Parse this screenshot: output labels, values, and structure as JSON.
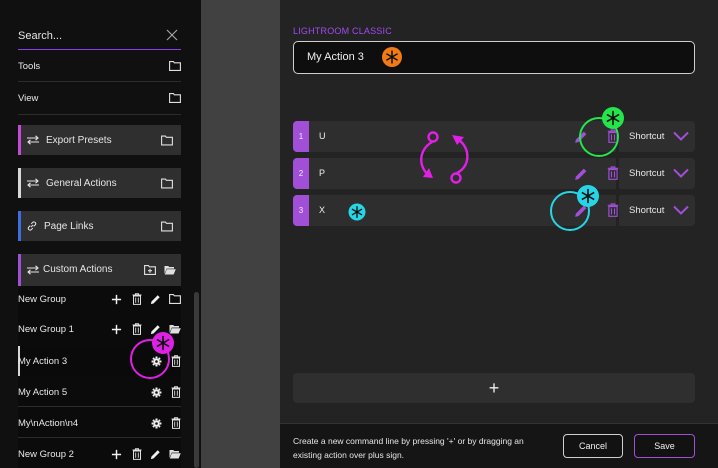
{
  "sidebar": {
    "search_placeholder": "Search...",
    "top_items": [
      {
        "label": "Tools"
      },
      {
        "label": "View"
      }
    ],
    "categories": {
      "export_presets": {
        "label": "Export Presets",
        "color": "#c34bd8"
      },
      "general_actions": {
        "label": "General Actions",
        "color": "#d8d8d8"
      },
      "page_links": {
        "label": "Page Links",
        "color": "#3c6ee0"
      },
      "custom_actions": {
        "label": "Custom Actions",
        "color": "#a24fd8"
      }
    },
    "custom_items": [
      {
        "label": "New Group"
      },
      {
        "label": "New Group 1"
      },
      {
        "label": "My Action 3"
      },
      {
        "label": "My Action 5"
      },
      {
        "label": "My\\nAction\\n4"
      },
      {
        "label": "New Group 2"
      }
    ]
  },
  "main": {
    "app_title": "LIGHTROOM CLASSIC",
    "action_name": "My Action 3",
    "commands": [
      {
        "number": "1",
        "key": "U",
        "shortcut_label": "Shortcut"
      },
      {
        "number": "2",
        "key": "P",
        "shortcut_label": "Shortcut"
      },
      {
        "number": "3",
        "key": "X",
        "shortcut_label": "Shortcut"
      }
    ],
    "add_label": "+",
    "hint": "Create a new command line by pressing '+' or by dragging an existing action over plus sign.",
    "cancel_label": "Cancel",
    "save_label": "Save"
  },
  "colors": {
    "accent": "#a24fd8",
    "annotation_orange": "#f07a18",
    "annotation_green": "#22e64a",
    "annotation_cyan": "#27d6e6",
    "annotation_magenta": "#e020e6"
  }
}
